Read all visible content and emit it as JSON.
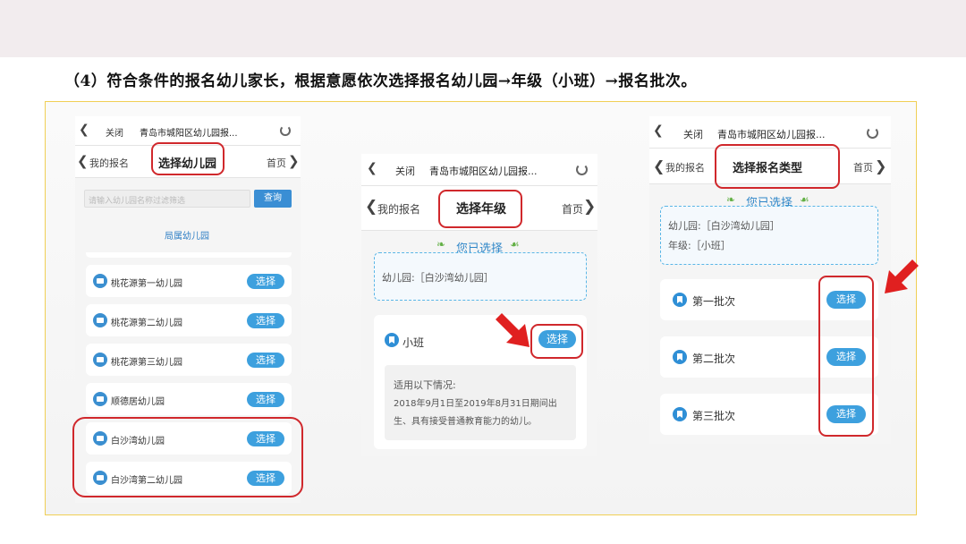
{
  "heading": "（4）符合条件的报名幼儿家长，根据意愿依次选择报名幼儿园→年级（小班）→报名批次。",
  "screens": {
    "kindergarten": {
      "close_label": "关闭",
      "window_title": "青岛市城阳区幼儿园报...",
      "back_label": "我的报名",
      "page_title": "选择幼儿园",
      "home_label": "首页",
      "search_placeholder": "请输入幼儿园名称过滤筛选",
      "search_button": "查询",
      "category_label": "局属幼儿园",
      "items": [
        {
          "name": "桃花源第一幼儿园",
          "button": "选择"
        },
        {
          "name": "桃花源第二幼儿园",
          "button": "选择"
        },
        {
          "name": "桃花源第三幼儿园",
          "button": "选择"
        },
        {
          "name": "顺德居幼儿园",
          "button": "选择"
        },
        {
          "name": "白沙湾幼儿园",
          "button": "选择"
        },
        {
          "name": "白沙湾第二幼儿园",
          "button": "选择"
        }
      ]
    },
    "grade": {
      "close_label": "关闭",
      "window_title": "青岛市城阳区幼儿园报...",
      "back_label": "我的报名",
      "page_title": "选择年级",
      "home_label": "首页",
      "selected_heading": "您已选择",
      "kindergarten_line": "幼儿园:［白沙湾幼儿园］",
      "class_name": "小班",
      "select_button": "选择",
      "conditions_title": "适用以下情况:",
      "conditions_line1": "2018年9月1日至2019年8月31日期间出",
      "conditions_line2": "生、具有接受普通教育能力的幼儿。"
    },
    "batch": {
      "close_label": "关闭",
      "window_title": "青岛市城阳区幼儿园报...",
      "back_label": "我的报名",
      "page_title": "选择报名类型",
      "home_label": "首页",
      "selected_heading": "您已选择",
      "kindergarten_line": "幼儿园:［白沙湾幼儿园］",
      "grade_line": "年级:［小班］",
      "batches": [
        {
          "name": "第一批次",
          "button": "选择"
        },
        {
          "name": "第二批次",
          "button": "选择"
        },
        {
          "name": "第三批次",
          "button": "选择"
        }
      ]
    }
  },
  "colors": {
    "accent_blue": "#3da0de",
    "highlight_red": "#d0282c",
    "frame_gold": "#f0cf55",
    "leaf_green": "#63b045"
  }
}
